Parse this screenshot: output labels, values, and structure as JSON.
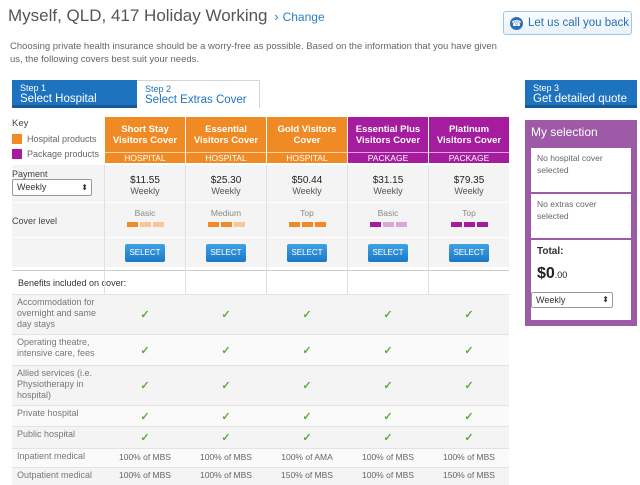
{
  "header": {
    "title": "Myself, QLD, 417 Holiday Working",
    "change_label": "Change",
    "callback_label": "Let us call you back"
  },
  "intro": "Choosing private health insurance should be a worry-free as possible. Based on the information that you have given us, the following covers best suit your needs.",
  "steps": [
    {
      "num": "Step 1",
      "label": "Select Hospital"
    },
    {
      "num": "Step 2",
      "label": "Select Extras Cover"
    },
    {
      "num": "Step 3",
      "label": "Get detailed quote"
    }
  ],
  "key": {
    "title": "Key",
    "hospital": "Hospital products",
    "package": "Package products",
    "colors": {
      "hospital": "#f08a24",
      "package": "#a51c9e"
    }
  },
  "payment": {
    "label": "Payment",
    "selected": "Weekly"
  },
  "cover_level_label": "Cover level",
  "select_label": "SELECT",
  "benefits_title": "Benefits included on cover:",
  "products": [
    {
      "name": "Short Stay Visitors Cover",
      "tag": "HOSPITAL",
      "price": "$11.55",
      "per": "Weekly",
      "level": "Basic",
      "level_num": 1,
      "b": [
        "Accommodation",
        "Operating",
        "Allied",
        "Private",
        "Public"
      ],
      "inpatient": "100% of MBS",
      "outpatient": "100% of MBS"
    },
    {
      "name": "Essential Visitors Cover",
      "tag": "HOSPITAL",
      "price": "$25.30",
      "per": "Weekly",
      "level": "Medium",
      "level_num": 2,
      "inpatient": "100% of MBS",
      "outpatient": "100% of MBS"
    },
    {
      "name": "Gold Visitors Cover",
      "tag": "HOSPITAL",
      "price": "$50.44",
      "per": "Weekly",
      "level": "Top",
      "level_num": 3,
      "inpatient": "100% of AMA",
      "outpatient": "150% of MBS"
    },
    {
      "name": "Essential Plus Visitors Cover",
      "tag": "PACKAGE",
      "price": "$31.15",
      "per": "Weekly",
      "level": "Basic",
      "level_num": 1,
      "inpatient": "100% of MBS",
      "outpatient": "100% of MBS"
    },
    {
      "name": "Platinum Visitors Cover",
      "tag": "PACKAGE",
      "price": "$79.35",
      "per": "Weekly",
      "level": "Top",
      "level_num": 3,
      "inpatient": "100% of MBS",
      "outpatient": "150% of MBS"
    }
  ],
  "benefits": [
    "Accommodation for overnight and same day stays",
    "Operating theatre, intensive care, fees",
    "Allied services (i.e. Physiotherapy in hospital)",
    "Private hospital",
    "Public hospital",
    "Inpatient medical",
    "Outpatient medical"
  ],
  "my_selection": {
    "title": "My selection",
    "hospital": "No hospital cover selected",
    "extras": "No extras cover selected",
    "total_label": "Total:",
    "amount": "$0",
    "cents": ".00",
    "frequency": "Weekly"
  }
}
